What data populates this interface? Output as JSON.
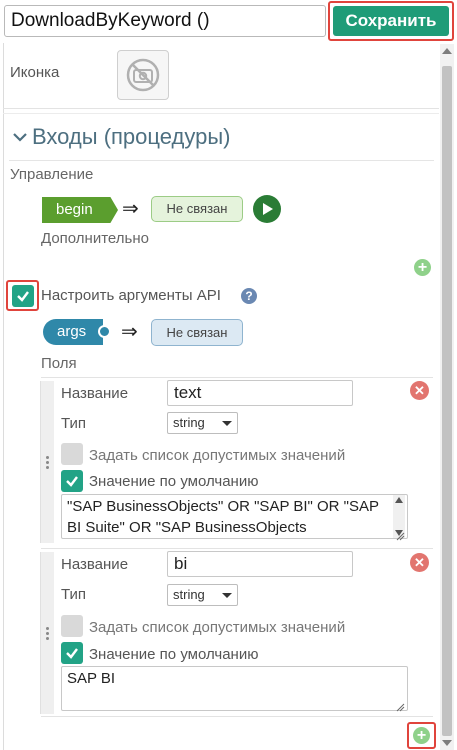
{
  "header": {
    "procedure_name": "DownloadByKeyword ()",
    "save_label": "Сохранить"
  },
  "icon_section": {
    "label": "Иконка",
    "icon": "image-disabled-icon"
  },
  "inputs": {
    "heading": "Входы (процедуры)",
    "control_label": "Управление",
    "begin_pin": "begin",
    "arrow": "⇒",
    "begin_status": "Не связан",
    "additional_label": "Дополнительно"
  },
  "api_args": {
    "checkbox_label": "Настроить аргументы API",
    "help_symbol": "?",
    "checked": true,
    "args_pin": "args",
    "args_status": "Не связан",
    "fields_label": "Поля"
  },
  "fields": [
    {
      "name_label": "Название",
      "name_value": "text",
      "type_label": "Тип",
      "type_value": "string",
      "allowed_values_label": "Задать список допустимых значений",
      "allowed_values_checked": false,
      "default_label": "Значение по умолчанию",
      "default_checked": true,
      "default_value": "\"SAP BusinessObjects\" OR \"SAP BI\" OR \"SAP BI Suite\" OR \"SAP BusinessObjects"
    },
    {
      "name_label": "Название",
      "name_value": "bi",
      "type_label": "Тип",
      "type_value": "string",
      "allowed_values_label": "Задать список допустимых значений",
      "allowed_values_checked": false,
      "default_label": "Значение по умолчанию",
      "default_checked": true,
      "default_value": "SAP BI"
    }
  ],
  "colors": {
    "accent_green": "#1f9c78",
    "highlight_red": "#e0443c",
    "begin_green": "#5b9e2e",
    "args_blue": "#2f88a9"
  }
}
